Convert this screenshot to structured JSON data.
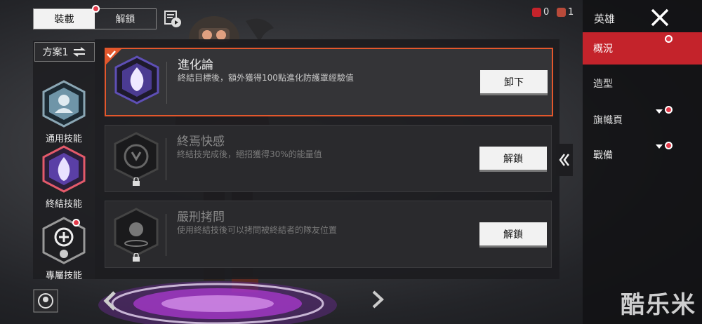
{
  "top_tabs": {
    "equip": "裝載",
    "unlock": "解鎖"
  },
  "plan": {
    "label": "方案1"
  },
  "categories": [
    {
      "label": "通用技能"
    },
    {
      "label": "終結技能"
    },
    {
      "label": "專屬技能"
    }
  ],
  "cards": [
    {
      "title": "進化論",
      "desc": "終結目標後，額外獲得100點進化防護罩經驗值",
      "button": "卸下",
      "selected": true,
      "locked": false
    },
    {
      "title": "終焉快感",
      "desc": "終結技完成後，絕招獲得30%的能量值",
      "button": "解鎖",
      "selected": false,
      "locked": true
    },
    {
      "title": "嚴刑拷問",
      "desc": "使用終結技後可以拷問被終結者的隊友位置",
      "button": "解鎖",
      "selected": false,
      "locked": true
    }
  ],
  "counters": {
    "a": "0",
    "b": "1"
  },
  "right_nav": {
    "header": "英雄",
    "items": [
      "概況",
      "造型",
      "旗幟頁",
      "戰備"
    ]
  },
  "watermark": "酷乐米",
  "colors": {
    "accent": "#e3572c",
    "nav_active": "#c4232b",
    "notify": "#e23a4a"
  }
}
